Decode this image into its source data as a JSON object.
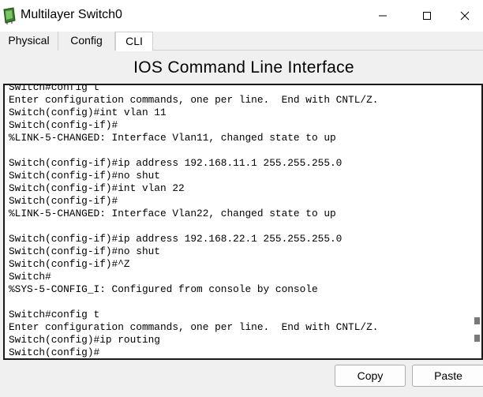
{
  "window": {
    "title": "Multilayer Switch0",
    "minimize_glyph": "—",
    "maximize_glyph": "☐",
    "close_glyph": "✕"
  },
  "tabs": [
    {
      "label": "Physical",
      "selected": false
    },
    {
      "label": "Config",
      "selected": false
    },
    {
      "label": "CLI",
      "selected": true
    }
  ],
  "heading": "IOS Command Line Interface",
  "terminal": {
    "lines": [
      "Switch#config t",
      "Enter configuration commands, one per line.  End with CNTL/Z.",
      "Switch(config)#int vlan 11",
      "Switch(config-if)#",
      "%LINK-5-CHANGED: Interface Vlan11, changed state to up",
      "",
      "Switch(config-if)#ip address 192.168.11.1 255.255.255.0",
      "Switch(config-if)#no shut",
      "Switch(config-if)#int vlan 22",
      "Switch(config-if)#",
      "%LINK-5-CHANGED: Interface Vlan22, changed state to up",
      "",
      "Switch(config-if)#ip address 192.168.22.1 255.255.255.0",
      "Switch(config-if)#no shut",
      "Switch(config-if)#^Z",
      "Switch#",
      "%SYS-5-CONFIG_I: Configured from console by console",
      "",
      "Switch#config t",
      "Enter configuration commands, one per line.  End with CNTL/Z.",
      "Switch(config)#ip routing",
      "Switch(config)#"
    ]
  },
  "buttons": {
    "copy": "Copy",
    "paste": "Paste"
  },
  "colors": {
    "terminal_border": "#1a1a1a",
    "window_bg": "#f0f0f0"
  }
}
